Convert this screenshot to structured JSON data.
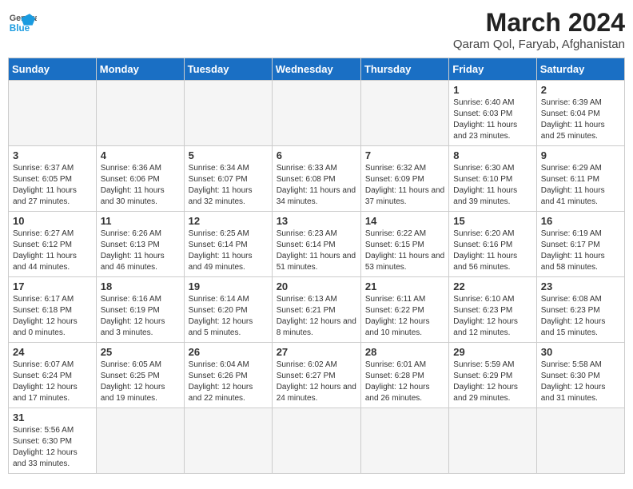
{
  "header": {
    "logo_general": "General",
    "logo_blue": "Blue",
    "month_year": "March 2024",
    "location": "Qaram Qol, Faryab, Afghanistan"
  },
  "weekdays": [
    "Sunday",
    "Monday",
    "Tuesday",
    "Wednesday",
    "Thursday",
    "Friday",
    "Saturday"
  ],
  "weeks": [
    [
      {
        "day": "",
        "info": ""
      },
      {
        "day": "",
        "info": ""
      },
      {
        "day": "",
        "info": ""
      },
      {
        "day": "",
        "info": ""
      },
      {
        "day": "",
        "info": ""
      },
      {
        "day": "1",
        "info": "Sunrise: 6:40 AM\nSunset: 6:03 PM\nDaylight: 11 hours\nand 23 minutes."
      },
      {
        "day": "2",
        "info": "Sunrise: 6:39 AM\nSunset: 6:04 PM\nDaylight: 11 hours\nand 25 minutes."
      }
    ],
    [
      {
        "day": "3",
        "info": "Sunrise: 6:37 AM\nSunset: 6:05 PM\nDaylight: 11 hours\nand 27 minutes."
      },
      {
        "day": "4",
        "info": "Sunrise: 6:36 AM\nSunset: 6:06 PM\nDaylight: 11 hours\nand 30 minutes."
      },
      {
        "day": "5",
        "info": "Sunrise: 6:34 AM\nSunset: 6:07 PM\nDaylight: 11 hours\nand 32 minutes."
      },
      {
        "day": "6",
        "info": "Sunrise: 6:33 AM\nSunset: 6:08 PM\nDaylight: 11 hours\nand 34 minutes."
      },
      {
        "day": "7",
        "info": "Sunrise: 6:32 AM\nSunset: 6:09 PM\nDaylight: 11 hours\nand 37 minutes."
      },
      {
        "day": "8",
        "info": "Sunrise: 6:30 AM\nSunset: 6:10 PM\nDaylight: 11 hours\nand 39 minutes."
      },
      {
        "day": "9",
        "info": "Sunrise: 6:29 AM\nSunset: 6:11 PM\nDaylight: 11 hours\nand 41 minutes."
      }
    ],
    [
      {
        "day": "10",
        "info": "Sunrise: 6:27 AM\nSunset: 6:12 PM\nDaylight: 11 hours\nand 44 minutes."
      },
      {
        "day": "11",
        "info": "Sunrise: 6:26 AM\nSunset: 6:13 PM\nDaylight: 11 hours\nand 46 minutes."
      },
      {
        "day": "12",
        "info": "Sunrise: 6:25 AM\nSunset: 6:14 PM\nDaylight: 11 hours\nand 49 minutes."
      },
      {
        "day": "13",
        "info": "Sunrise: 6:23 AM\nSunset: 6:14 PM\nDaylight: 11 hours\nand 51 minutes."
      },
      {
        "day": "14",
        "info": "Sunrise: 6:22 AM\nSunset: 6:15 PM\nDaylight: 11 hours\nand 53 minutes."
      },
      {
        "day": "15",
        "info": "Sunrise: 6:20 AM\nSunset: 6:16 PM\nDaylight: 11 hours\nand 56 minutes."
      },
      {
        "day": "16",
        "info": "Sunrise: 6:19 AM\nSunset: 6:17 PM\nDaylight: 11 hours\nand 58 minutes."
      }
    ],
    [
      {
        "day": "17",
        "info": "Sunrise: 6:17 AM\nSunset: 6:18 PM\nDaylight: 12 hours\nand 0 minutes."
      },
      {
        "day": "18",
        "info": "Sunrise: 6:16 AM\nSunset: 6:19 PM\nDaylight: 12 hours\nand 3 minutes."
      },
      {
        "day": "19",
        "info": "Sunrise: 6:14 AM\nSunset: 6:20 PM\nDaylight: 12 hours\nand 5 minutes."
      },
      {
        "day": "20",
        "info": "Sunrise: 6:13 AM\nSunset: 6:21 PM\nDaylight: 12 hours\nand 8 minutes."
      },
      {
        "day": "21",
        "info": "Sunrise: 6:11 AM\nSunset: 6:22 PM\nDaylight: 12 hours\nand 10 minutes."
      },
      {
        "day": "22",
        "info": "Sunrise: 6:10 AM\nSunset: 6:23 PM\nDaylight: 12 hours\nand 12 minutes."
      },
      {
        "day": "23",
        "info": "Sunrise: 6:08 AM\nSunset: 6:23 PM\nDaylight: 12 hours\nand 15 minutes."
      }
    ],
    [
      {
        "day": "24",
        "info": "Sunrise: 6:07 AM\nSunset: 6:24 PM\nDaylight: 12 hours\nand 17 minutes."
      },
      {
        "day": "25",
        "info": "Sunrise: 6:05 AM\nSunset: 6:25 PM\nDaylight: 12 hours\nand 19 minutes."
      },
      {
        "day": "26",
        "info": "Sunrise: 6:04 AM\nSunset: 6:26 PM\nDaylight: 12 hours\nand 22 minutes."
      },
      {
        "day": "27",
        "info": "Sunrise: 6:02 AM\nSunset: 6:27 PM\nDaylight: 12 hours\nand 24 minutes."
      },
      {
        "day": "28",
        "info": "Sunrise: 6:01 AM\nSunset: 6:28 PM\nDaylight: 12 hours\nand 26 minutes."
      },
      {
        "day": "29",
        "info": "Sunrise: 5:59 AM\nSunset: 6:29 PM\nDaylight: 12 hours\nand 29 minutes."
      },
      {
        "day": "30",
        "info": "Sunrise: 5:58 AM\nSunset: 6:30 PM\nDaylight: 12 hours\nand 31 minutes."
      }
    ],
    [
      {
        "day": "31",
        "info": "Sunrise: 5:56 AM\nSunset: 6:30 PM\nDaylight: 12 hours\nand 33 minutes."
      },
      {
        "day": "",
        "info": ""
      },
      {
        "day": "",
        "info": ""
      },
      {
        "day": "",
        "info": ""
      },
      {
        "day": "",
        "info": ""
      },
      {
        "day": "",
        "info": ""
      },
      {
        "day": "",
        "info": ""
      }
    ]
  ]
}
